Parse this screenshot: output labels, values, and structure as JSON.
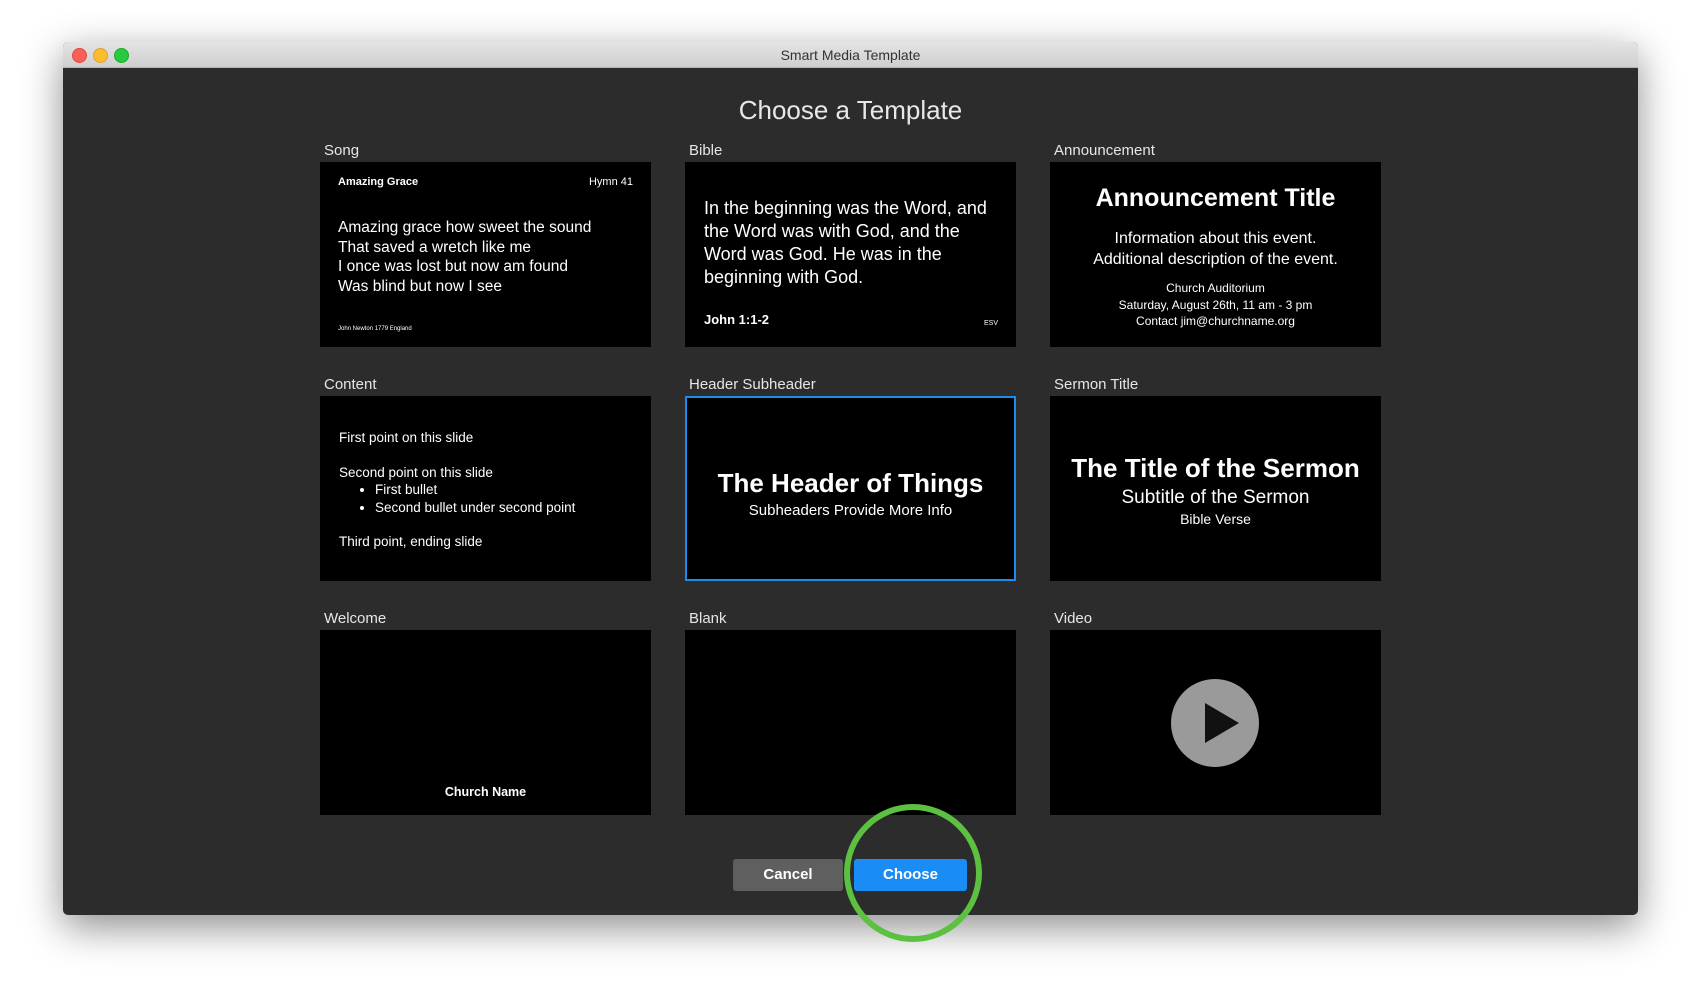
{
  "window": {
    "title": "Smart Media Template"
  },
  "heading": "Choose a Template",
  "templates": {
    "song": {
      "label": "Song",
      "title": "Amazing Grace",
      "hymn": "Hymn 41",
      "lines": [
        "Amazing grace how sweet the sound",
        "That saved a wretch like me",
        "I once was lost but now am found",
        "Was blind but now I see"
      ],
      "credit": "John Newton 1779 England"
    },
    "bible": {
      "label": "Bible",
      "text": "In the beginning was the Word, and the Word was with God, and the Word was God.  He was in the beginning with God.",
      "reference": "John 1:1-2",
      "version": "ESV"
    },
    "announcement": {
      "label": "Announcement",
      "title": "Announcement Title",
      "info": [
        "Information about this event.",
        "Additional description of the event."
      ],
      "details": [
        "Church Auditorium",
        "Saturday, August 26th, 11 am - 3 pm",
        "Contact jim@churchname.org"
      ]
    },
    "content": {
      "label": "Content",
      "point1": "First point on this slide",
      "point2": "Second point on this slide",
      "bullets": [
        "First bullet",
        "Second bullet under second point"
      ],
      "point3": "Third point, ending slide"
    },
    "header_subheader": {
      "label": "Header Subheader",
      "header": "The Header of Things",
      "subheader": "Subheaders Provide More Info"
    },
    "sermon_title": {
      "label": "Sermon Title",
      "title": "The Title of the Sermon",
      "subtitle": "Subtitle of the Sermon",
      "verse": "Bible Verse"
    },
    "welcome": {
      "label": "Welcome",
      "church_name": "Church Name"
    },
    "blank": {
      "label": "Blank"
    },
    "video": {
      "label": "Video",
      "icon": "play-icon"
    }
  },
  "selected_template": "Header Subheader",
  "buttons": {
    "cancel": "Cancel",
    "choose": "Choose"
  },
  "colors": {
    "window_bg": "#2c2c2c",
    "thumbnail_bg": "#000000",
    "selection": "#1a8cf0",
    "choose_button": "#1a8cf5",
    "cancel_button": "#5f5f5f",
    "highlight_ring": "#5cc040"
  }
}
